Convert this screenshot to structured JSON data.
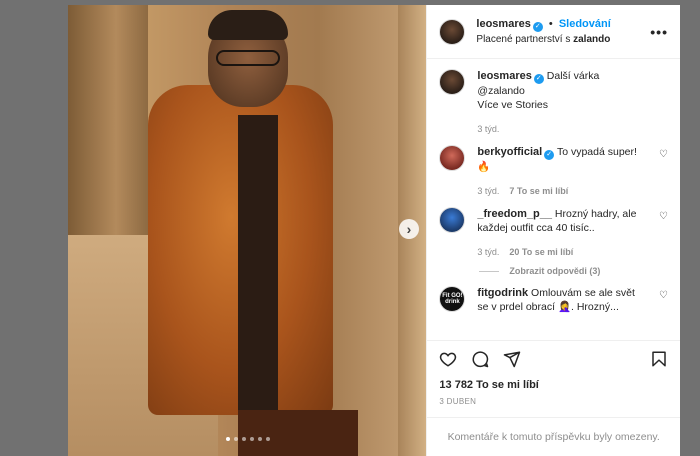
{
  "post": {
    "carousel": {
      "count": 6,
      "active_index": 0,
      "next_glyph": "›"
    }
  },
  "header": {
    "username": "leosmares",
    "follow_label": "Sledování",
    "separator": "•",
    "partnership_prefix": "Placené partnerství s",
    "partner": "zalando",
    "more_glyph": "•••"
  },
  "caption": {
    "username": "leosmares",
    "text": "Další várka @zalando",
    "line2": "Více ve Stories",
    "time": "3 týd."
  },
  "comments": [
    {
      "username": "berkyofficial",
      "verified": true,
      "text": "To vypadá super! 🔥",
      "time": "3 týd.",
      "likes": "7 To se mi líbí"
    },
    {
      "username": "_freedom_p__",
      "verified": false,
      "text": "Hrozný hadry, ale každej outfit cca 40 tisíc..",
      "time": "3 týd.",
      "likes": "20 To se mi líbí",
      "replies": "Zobrazit odpovědi (3)"
    },
    {
      "username": "fitgodrink",
      "verified": false,
      "text": "Omlouvám se ale svět se v prdel obrací 🤦‍♀️. Hrozný...",
      "avatar_text": "Fit GO! drink"
    }
  ],
  "actions": {
    "like_icon": "heart-outline-icon",
    "comment_icon": "comment-icon",
    "share_icon": "share-icon",
    "save_icon": "bookmark-icon"
  },
  "likes_total": "13 782 To se mi líbí",
  "date": "3 DUBEN",
  "restricted_notice": "Komentáře k tomuto příspěvku byly omezeny.",
  "colors": {
    "accent": "#0095f6",
    "verified": "#1d9bf0",
    "text": "#262626",
    "muted": "#8e8e8e"
  }
}
